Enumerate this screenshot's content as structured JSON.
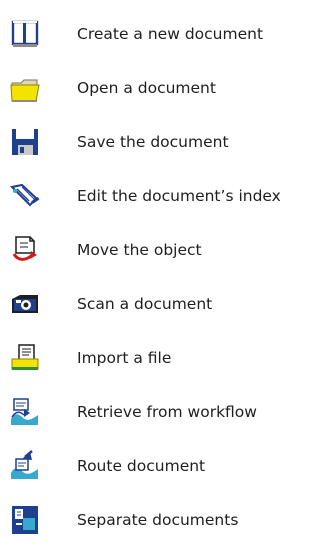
{
  "toolbar_legend": {
    "items": [
      {
        "icon": "new-document-icon",
        "label": "Create a new document"
      },
      {
        "icon": "open-folder-icon",
        "label": "Open a document"
      },
      {
        "icon": "floppy-disk-icon",
        "label": "Save the document"
      },
      {
        "icon": "edit-index-icon",
        "label": "Edit the document’s index"
      },
      {
        "icon": "move-object-icon",
        "label": "Move the object"
      },
      {
        "icon": "scanner-icon",
        "label": "Scan a document"
      },
      {
        "icon": "import-file-icon",
        "label": "Import a file"
      },
      {
        "icon": "retrieve-workflow-icon",
        "label": "Retrieve from workflow"
      },
      {
        "icon": "route-document-icon",
        "label": "Route document"
      },
      {
        "icon": "separate-documents-icon",
        "label": "Separate documents"
      }
    ]
  },
  "colors": {
    "icon_blue": "#1f3f8f",
    "icon_yellow": "#f4e300",
    "icon_gray": "#8c8c8c",
    "icon_red": "#d11b1b",
    "icon_cyan": "#37a9cf",
    "icon_green": "#2b8f3a"
  }
}
